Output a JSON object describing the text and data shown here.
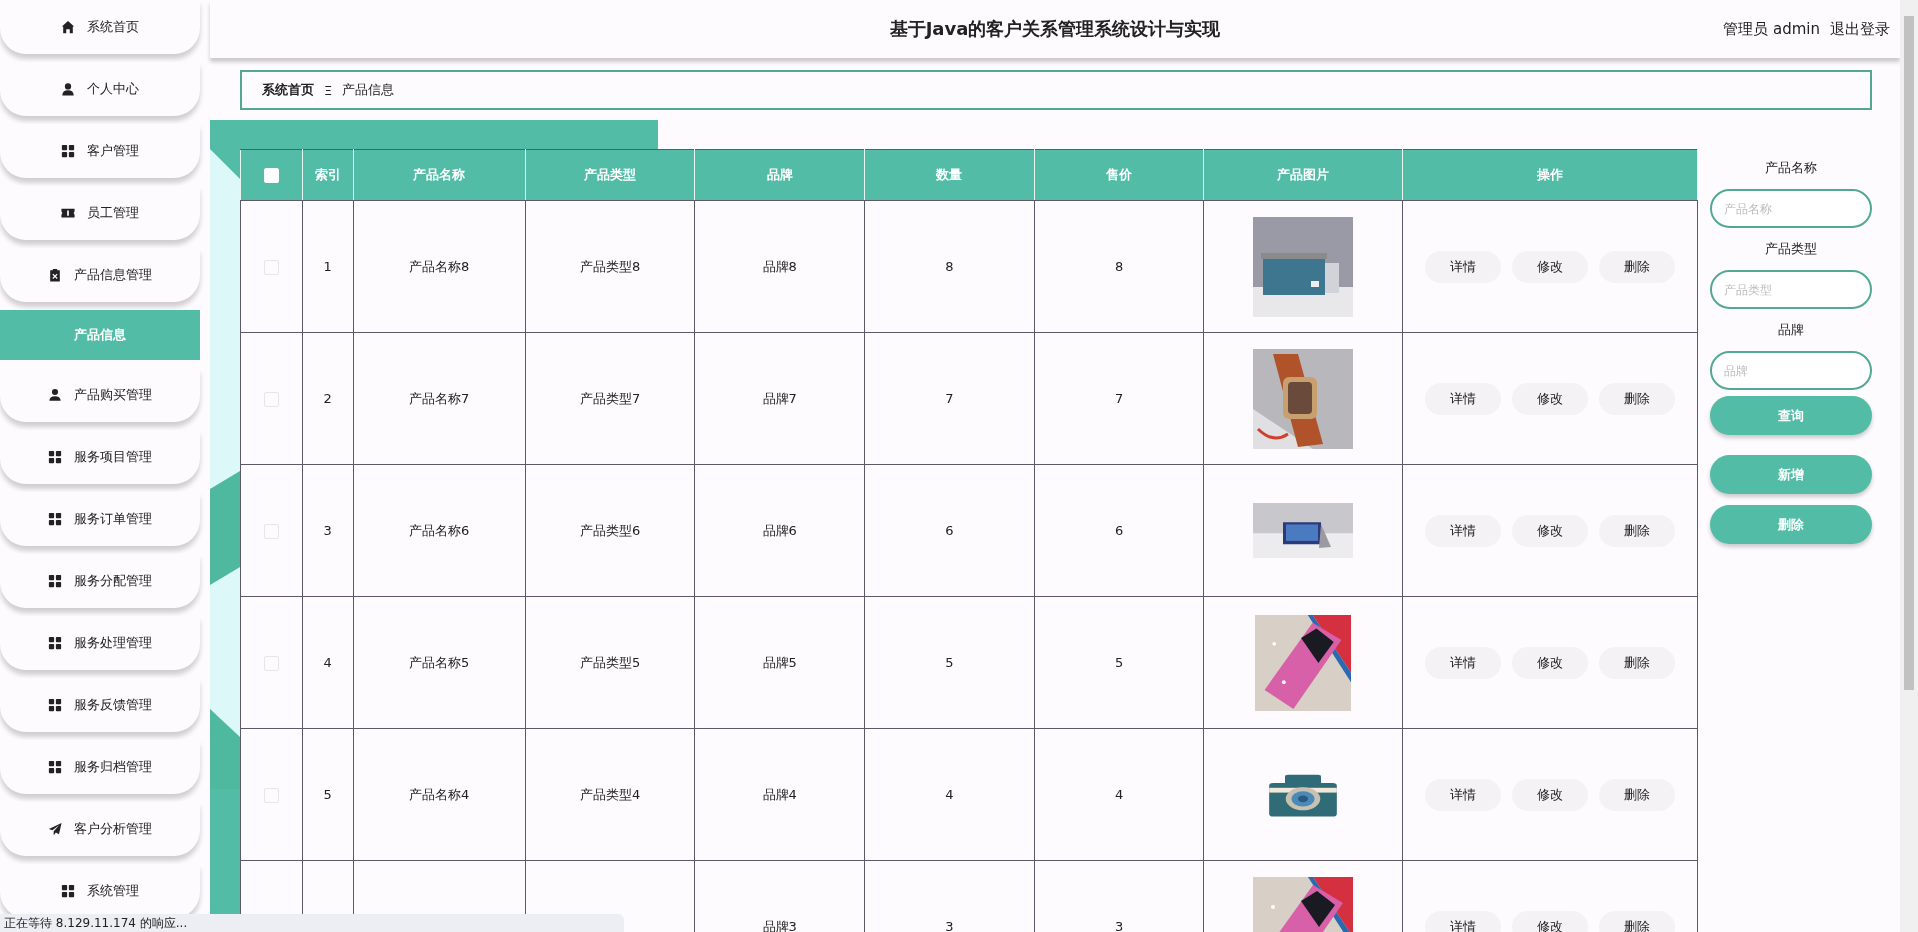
{
  "header": {
    "title": "基于Java的客户关系管理系统设计与实现",
    "user": "管理员 admin",
    "logout": "退出登录"
  },
  "sidebar": {
    "items": [
      {
        "label": "系统首页",
        "kind": "home",
        "selected": false
      },
      {
        "label": "个人中心",
        "kind": "user",
        "selected": false
      },
      {
        "label": "客户管理",
        "kind": "grid",
        "selected": false
      },
      {
        "label": "员工管理",
        "kind": "ticket",
        "selected": false
      },
      {
        "label": "产品信息管理",
        "kind": "clipboard",
        "selected": false
      },
      {
        "label": "产品信息",
        "kind": "sub",
        "selected": true
      },
      {
        "label": "产品购买管理",
        "kind": "person",
        "selected": false
      },
      {
        "label": "服务项目管理",
        "kind": "grid",
        "selected": false
      },
      {
        "label": "服务订单管理",
        "kind": "grid",
        "selected": false
      },
      {
        "label": "服务分配管理",
        "kind": "grid",
        "selected": false
      },
      {
        "label": "服务处理管理",
        "kind": "grid",
        "selected": false
      },
      {
        "label": "服务反馈管理",
        "kind": "grid",
        "selected": false
      },
      {
        "label": "服务归档管理",
        "kind": "grid",
        "selected": false
      },
      {
        "label": "客户分析管理",
        "kind": "send",
        "selected": false
      },
      {
        "label": "系统管理",
        "kind": "grid",
        "selected": false
      }
    ]
  },
  "breadcrumb": {
    "home": "系统首页",
    "separator": "Ξ",
    "current": "产品信息"
  },
  "table": {
    "select_all": {
      "checked": false
    },
    "columns": [
      "索引",
      "产品名称",
      "产品类型",
      "品牌",
      "数量",
      "售价",
      "产品图片",
      "操作"
    ],
    "rows": [
      {
        "checked": false,
        "index": "1",
        "name": "产品名称8",
        "type": "产品类型8",
        "brand": "品牌8",
        "quantity": "8",
        "price": "8",
        "actions": [
          "详情",
          "修改",
          "删除"
        ]
      },
      {
        "checked": false,
        "index": "2",
        "name": "产品名称7",
        "type": "产品类型7",
        "brand": "品牌7",
        "quantity": "7",
        "price": "7",
        "actions": [
          "详情",
          "修改",
          "删除"
        ]
      },
      {
        "checked": false,
        "index": "3",
        "name": "产品名称6",
        "type": "产品类型6",
        "brand": "品牌6",
        "quantity": "6",
        "price": "6",
        "actions": [
          "详情",
          "修改",
          "删除"
        ]
      },
      {
        "checked": false,
        "index": "4",
        "name": "产品名称5",
        "type": "产品类型5",
        "brand": "品牌5",
        "quantity": "5",
        "price": "5",
        "actions": [
          "详情",
          "修改",
          "删除"
        ]
      },
      {
        "checked": false,
        "index": "5",
        "name": "产品名称4",
        "type": "产品类型4",
        "brand": "品牌4",
        "quantity": "4",
        "price": "4",
        "actions": [
          "详情",
          "修改",
          "删除"
        ]
      },
      {
        "brand": "品牌3",
        "quantity": "3",
        "price": "3",
        "actions": [
          "详情",
          "修改",
          "删除"
        ]
      }
    ]
  },
  "search_panel": {
    "fields": [
      {
        "label": "产品名称",
        "placeholder": "产品名称"
      },
      {
        "label": "产品类型",
        "placeholder": "产品类型"
      },
      {
        "label": "品牌",
        "placeholder": "品牌"
      }
    ],
    "buttons": [
      {
        "label": "查询",
        "kind": "search"
      },
      {
        "label": "新增",
        "kind": "add"
      },
      {
        "label": "删除",
        "kind": "delete"
      }
    ]
  },
  "status_bar": {
    "text": "正在等待 8.129.11.174 的响应..."
  }
}
